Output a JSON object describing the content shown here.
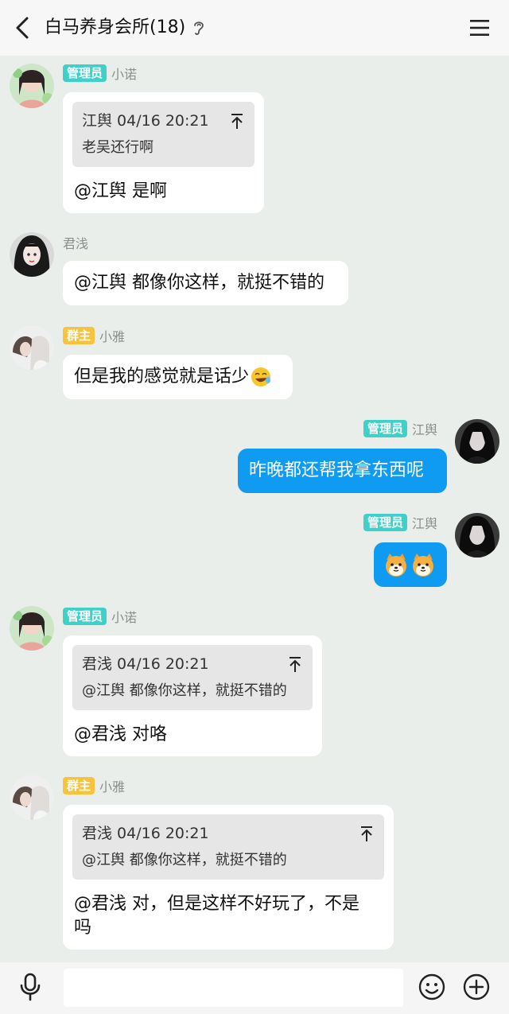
{
  "header": {
    "title": "白马养身会所(18)"
  },
  "messages": [
    {
      "side": "left",
      "badge": "管理员",
      "nick": "小诺",
      "quote": {
        "head": "江舆 04/16 20:21",
        "body": "老吴还行啊"
      },
      "text": "@江舆 是啊"
    },
    {
      "side": "left",
      "nick": "君浅",
      "text": "@江舆 都像你这样，就挺不错的"
    },
    {
      "side": "left",
      "badge": "群主",
      "nick": "小雅",
      "text": "但是我的感觉就是话少"
    },
    {
      "side": "right",
      "badge": "管理员",
      "nick": "江舆",
      "text": "昨晚都还帮我拿东西呢"
    },
    {
      "side": "right",
      "badge": "管理员",
      "nick": "江舆",
      "sticker": "two-shiba-emoji"
    },
    {
      "side": "left",
      "badge": "管理员",
      "nick": "小诺",
      "quote": {
        "head": "君浅 04/16 20:21",
        "body": "@江舆 都像你这样，就挺不错的"
      },
      "text": "@君浅 对咯"
    },
    {
      "side": "left",
      "badge": "群主",
      "nick": "小雅",
      "quote": {
        "head": "君浅 04/16 20:21",
        "body": "@江舆 都像你这样，就挺不错的"
      },
      "text_line1": "@君浅 对，但是这样不好玩了，不是",
      "text_line2": "吗"
    }
  ],
  "input": {
    "value": "",
    "placeholder": ""
  },
  "colors": {
    "chat_bg": "#e9eeeb",
    "my_bubble": "#0f9bf2",
    "admin_badge": "#3fd1c9",
    "owner_badge": "#f7c23c"
  }
}
